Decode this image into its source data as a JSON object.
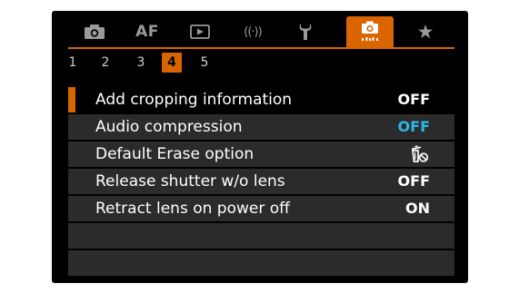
{
  "colors": {
    "accent": "#d96400",
    "background": "#000000",
    "row_bg": "#2b2b2b",
    "text": "#ffffff",
    "value_highlight": "#2fb6e8",
    "inactive_tab": "#9a9a9a"
  },
  "tabs": [
    {
      "icon": "camera-icon",
      "label": "",
      "active": false
    },
    {
      "icon": "af-icon",
      "label": "AF",
      "active": false
    },
    {
      "icon": "playback-icon",
      "label": "",
      "active": false
    },
    {
      "icon": "wireless-icon",
      "label": "((·))",
      "active": false
    },
    {
      "icon": "wrench-icon",
      "label": "",
      "active": false
    },
    {
      "icon": "custom-function-camera-icon",
      "label": "",
      "active": true
    },
    {
      "icon": "star-icon",
      "label": "★",
      "active": false
    }
  ],
  "pages": [
    "1",
    "2",
    "3",
    "4",
    "5"
  ],
  "active_page": "4",
  "menu": {
    "items": [
      {
        "label": "Add cropping information",
        "value": "OFF",
        "selected": true
      },
      {
        "label": "Audio compression",
        "value": "OFF",
        "selected": false
      },
      {
        "label": "Default Erase option",
        "value": "",
        "value_icon": "erase-cancel-icon",
        "selected": false
      },
      {
        "label": "Release shutter w/o lens",
        "value": "OFF",
        "selected": false
      },
      {
        "label": "Retract lens on power off",
        "value": "ON",
        "selected": false
      },
      {
        "label": "",
        "value": "",
        "selected": false
      },
      {
        "label": "",
        "value": "",
        "selected": false
      }
    ]
  }
}
